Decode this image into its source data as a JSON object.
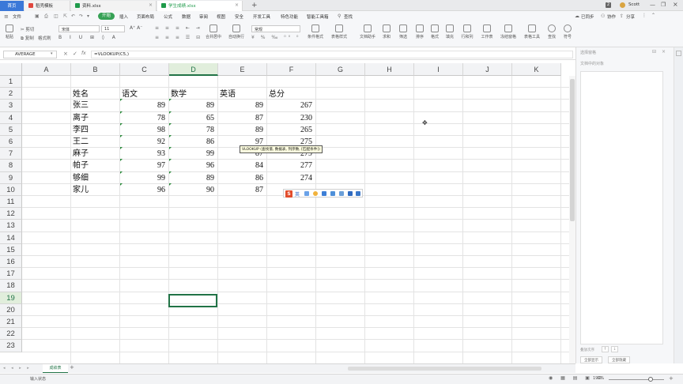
{
  "titlebar": {
    "home_tab": "首页",
    "tabs": [
      {
        "label": "稻壳模板",
        "icon_color": "#e0473e",
        "active": false
      },
      {
        "label": "资料.xlsx",
        "icon_color": "#1f9a4a",
        "active": false
      },
      {
        "label": "学生成绩.xlsx",
        "icon_color": "#1f9a4a",
        "active": true
      }
    ],
    "add_tab": "+",
    "account": "Scott",
    "badge": "2"
  },
  "menubar": {
    "file": "文件",
    "items": [
      "开始",
      "插入",
      "页面布局",
      "公式",
      "数据",
      "审阅",
      "视图",
      "安全",
      "开发工具",
      "特色功能",
      "智能工具箱"
    ],
    "search": "查找",
    "sync": "已同步",
    "collab": "协作",
    "share": "分享"
  },
  "ribbon": {
    "paste": "粘贴",
    "cut": "剪切",
    "copy": "复制",
    "format_painter": "格式刷",
    "font_name": "宋体",
    "font_size": "11",
    "merge": "合并居中",
    "wrap": "自动换行",
    "number_format": "常规",
    "cond_format": "条件格式",
    "cell_style": "表格样式",
    "doc_helper": "文档助手",
    "sum": "求和",
    "filter": "筛选",
    "sort": "排序",
    "fill_color": "格式",
    "fill": "填充",
    "rowcol": "行和列",
    "worksheet": "工作表",
    "freeze": "冻结窗格",
    "table_tools": "表格工具",
    "find": "查找",
    "symbol": "符号"
  },
  "formulabar": {
    "namebox": "AVERAGE",
    "fx": "fx",
    "formula": "=VLOOKUP(C5,)"
  },
  "grid": {
    "columns": [
      "A",
      "B",
      "C",
      "D",
      "E",
      "F",
      "G",
      "H",
      "I",
      "J",
      "K"
    ],
    "selected_column": "D",
    "rows": [
      "1",
      "2",
      "3",
      "4",
      "5",
      "6",
      "7",
      "8",
      "9",
      "10",
      "11",
      "12",
      "13",
      "14",
      "15",
      "16",
      "17",
      "18",
      "19",
      "20",
      "21",
      "22",
      "23"
    ],
    "selected_row": "19",
    "header_row": [
      "姓名",
      "语文",
      "数学",
      "英语",
      "总分"
    ],
    "data": [
      {
        "name": "张三",
        "chinese": "89",
        "math": "89",
        "english": "89",
        "total": "267"
      },
      {
        "name": "离子",
        "chinese": "78",
        "math": "65",
        "english": "87",
        "total": "230"
      },
      {
        "name": "李四",
        "chinese": "98",
        "math": "78",
        "english": "89",
        "total": "265"
      },
      {
        "name": "王二",
        "chinese": "92",
        "math": "86",
        "english": "97",
        "total": "275"
      },
      {
        "name": "麻子",
        "chinese": "93",
        "math": "99",
        "english": "87",
        "total": "279"
      },
      {
        "name": "帕子",
        "chinese": "97",
        "math": "96",
        "english": "84",
        "total": "277"
      },
      {
        "name": "够细",
        "chinese": "99",
        "math": "89",
        "english": "86",
        "total": "274"
      },
      {
        "name": "家儿",
        "chinese": "96",
        "math": "90",
        "english": "87",
        "total": ""
      }
    ]
  },
  "tooltip": "VLOOKUP (查找值, 数据表, 列序数, [匹配条件])",
  "rightpanel": {
    "title": "选择窗格",
    "subtitle": "文档中的对象",
    "order_label": "叠放次序",
    "show_all": "全部显示",
    "hide_all": "全部隐藏"
  },
  "sheetbar": {
    "sheet": "成绩表",
    "add": "+"
  },
  "statusbar": {
    "mode": "输入状态",
    "zoom": "190%"
  },
  "colors": {
    "accent": "#217346",
    "start_green": "#36a155",
    "home_blue": "#3b78d8"
  }
}
